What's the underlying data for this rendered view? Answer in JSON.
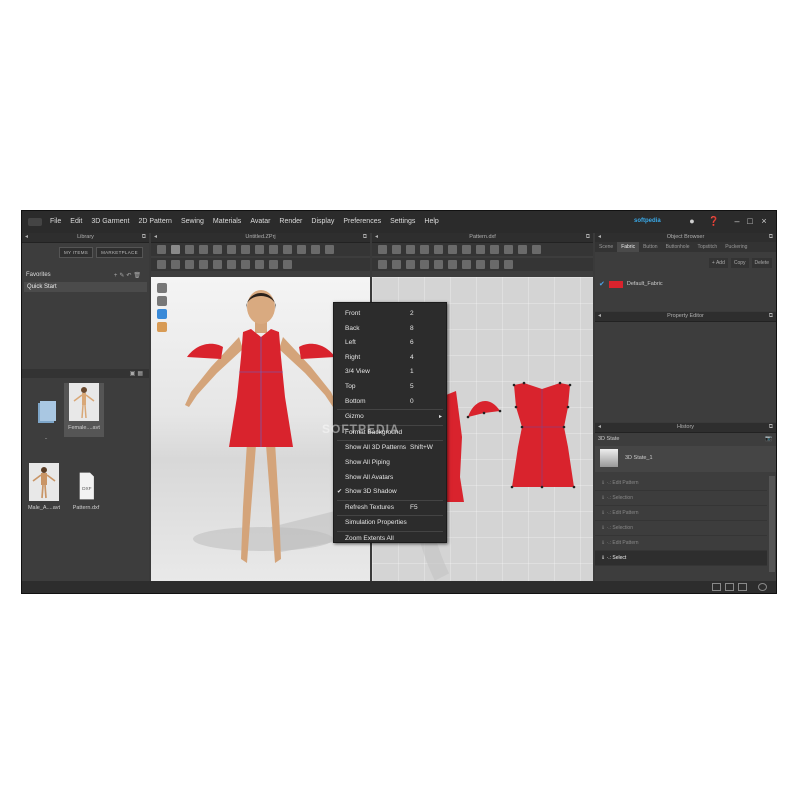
{
  "menubar": {
    "menus": [
      "File",
      "Edit",
      "3D Garment",
      "2D Pattern",
      "Sewing",
      "Materials",
      "Avatar",
      "Render",
      "Display",
      "Preferences",
      "Settings",
      "Help"
    ],
    "brand": "softpedia"
  },
  "library": {
    "title": "Library",
    "tabs": [
      "MY ITEMS",
      "MARKETPLACE"
    ],
    "favorites_label": "Favorites",
    "quick_start": "Quick Start",
    "files": [
      {
        "name": ".."
      },
      {
        "name": "Female....avt"
      },
      {
        "name": "Male_A....avt"
      },
      {
        "name": "Pattern.dxf",
        "badge": "DXF"
      }
    ]
  },
  "viewport3d": {
    "title": "Untitled.ZPrj"
  },
  "viewport2d": {
    "title": "Pattern.dxf"
  },
  "object_browser": {
    "title": "Object Browser",
    "tabs": [
      "Scene",
      "Fabric",
      "Button",
      "Buttonhole",
      "Topstitch",
      "Puckering"
    ],
    "active_tab": "Fabric",
    "buttons": [
      "+ Add",
      "Copy",
      "Delete"
    ],
    "fabric_item": "Default_Fabric",
    "fabric_color": "#d9232d"
  },
  "property_editor": {
    "title": "Property Editor"
  },
  "history": {
    "title": "History",
    "state_header": "3D State",
    "state_item": "3D State_1",
    "rows": [
      "Edit Pattern",
      "Selection",
      "Edit Pattern",
      "Selection",
      "Edit Pattern"
    ],
    "current": "Select"
  },
  "context_menu": {
    "items": [
      {
        "label": "Front",
        "shortcut": "2"
      },
      {
        "label": "Back",
        "shortcut": "8"
      },
      {
        "label": "Left",
        "shortcut": "6"
      },
      {
        "label": "Right",
        "shortcut": "4"
      },
      {
        "label": "3/4 View",
        "shortcut": "1"
      },
      {
        "label": "Top",
        "shortcut": "5"
      },
      {
        "label": "Bottom",
        "shortcut": "0"
      },
      {
        "label": "Gizmo",
        "shortcut": ""
      },
      {
        "label": "Format Background",
        "shortcut": ""
      },
      {
        "label": "Show All 3D Patterns",
        "shortcut": "Shift+W"
      },
      {
        "label": "Show All Piping",
        "shortcut": ""
      },
      {
        "label": "Show All Avatars",
        "shortcut": ""
      },
      {
        "label": "Show 3D Shadow",
        "shortcut": ""
      },
      {
        "label": "Refresh Textures",
        "shortcut": "F5"
      },
      {
        "label": "Simulation Properties",
        "shortcut": ""
      },
      {
        "label": "Zoom Extents All",
        "shortcut": ""
      }
    ],
    "checked_item": "Show 3D Shadow",
    "submenu_item": "Gizmo"
  },
  "watermark": "SOFTPEDIA",
  "colors": {
    "garment": "#d9232d",
    "accent": "#3a8ad8",
    "panel": "#3d3d3d"
  }
}
